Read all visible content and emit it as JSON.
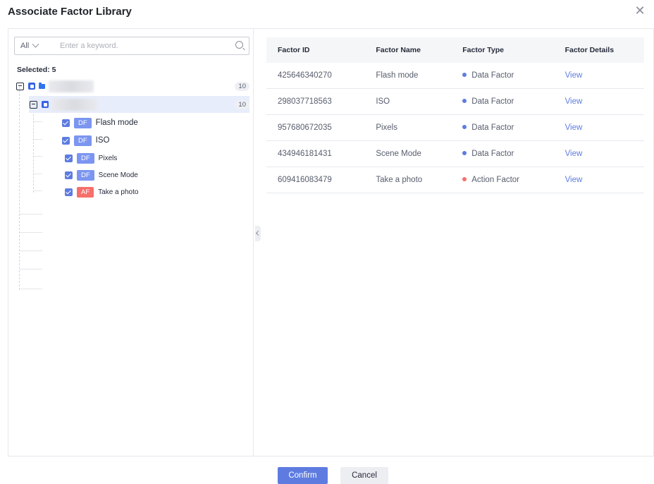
{
  "dialog": {
    "title": "Associate Factor Library",
    "close_icon": "close-icon"
  },
  "search": {
    "scope_value": "All",
    "placeholder": "Enter a keyword.",
    "icon": "search-icon"
  },
  "tree": {
    "selected_label": "Selected: 5",
    "root": {
      "count": "10",
      "icon": "folder-icon"
    },
    "group": {
      "count": "10"
    },
    "leaves": [
      {
        "tag": "DF",
        "label": "Flash mode",
        "checked": true
      },
      {
        "tag": "DF",
        "label": "ISO",
        "checked": true
      },
      {
        "tag": "DF",
        "label": "Pixels",
        "checked": true
      },
      {
        "tag": "DF",
        "label": "Scene Mode",
        "checked": true
      },
      {
        "tag": "AF",
        "label": "Take a photo",
        "checked": true
      }
    ]
  },
  "table": {
    "headers": [
      "Factor ID",
      "Factor Name",
      "Factor Type",
      "Factor Details"
    ],
    "rows": [
      {
        "id": "425646340270",
        "name": "Flash mode",
        "type": "Data Factor",
        "details": "View"
      },
      {
        "id": "298037718563",
        "name": "ISO",
        "type": "Data Factor",
        "details": "View"
      },
      {
        "id": "957680672035",
        "name": "Pixels",
        "type": "Data Factor",
        "details": "View"
      },
      {
        "id": "434946181431",
        "name": "Scene Mode",
        "type": "Data Factor",
        "details": "View"
      },
      {
        "id": "609416083479",
        "name": "Take a photo",
        "type": "Action Factor",
        "details": "View"
      }
    ]
  },
  "colors": {
    "data_factor": "#5e7ce0",
    "action_factor": "#f66f6a",
    "primary": "#5e7ce0"
  },
  "footer": {
    "confirm_label": "Confirm",
    "cancel_label": "Cancel"
  }
}
